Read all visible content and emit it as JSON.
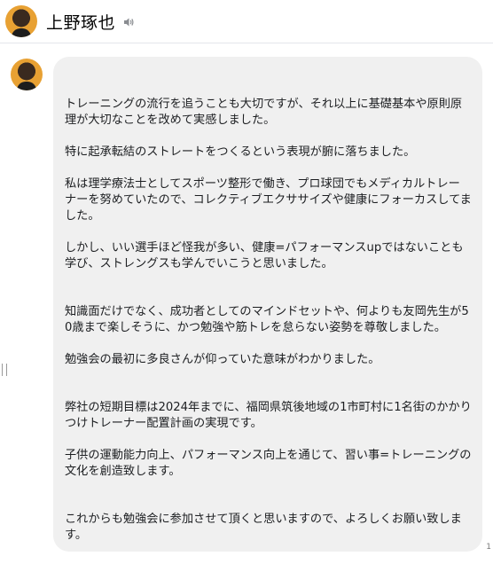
{
  "header": {
    "name": "上野琢也"
  },
  "message": {
    "paragraphs": [
      "トレーニングの流行を追うことも大切ですが、それ以上に基礎基本や原則原理が大切なことを改めて実感しました。\n\n特に起承転結のストレートをつくるという表現が腑に落ちました。\n\n私は理学療法士としてスポーツ整形で働き、プロ球団でもメディカルトレーナーを努めていたので、コレクティブエクササイズや健康にフォーカスしてました。\n\nしかし、いい選手ほど怪我が多い、健康=パフォーマンスupではないことも学び、ストレングスも学んでいこうと思いました。\n\n\n知識面だけでなく、成功者としてのマインドセットや、何よりも友岡先生が50歳まで楽しそうに、かつ勉強や筋トレを怠らない姿勢を尊敬しました。\n\n勉強会の最初に多良さんが仰っていた意味がわかりました。\n\n\n弊社の短期目標は2024年までに、福岡県筑後地域の1市町村に1名街のかかりつけトレーナー配置計画の実現です。\n\n子供の運動能力向上、パフォーマンス向上を通じて、習い事=トレーニングの文化を創造致します。\n\n\nこれからも勉強会に参加させて頂くと思いますので、よろしくお願い致します。"
    ]
  },
  "corner_mark": "1"
}
